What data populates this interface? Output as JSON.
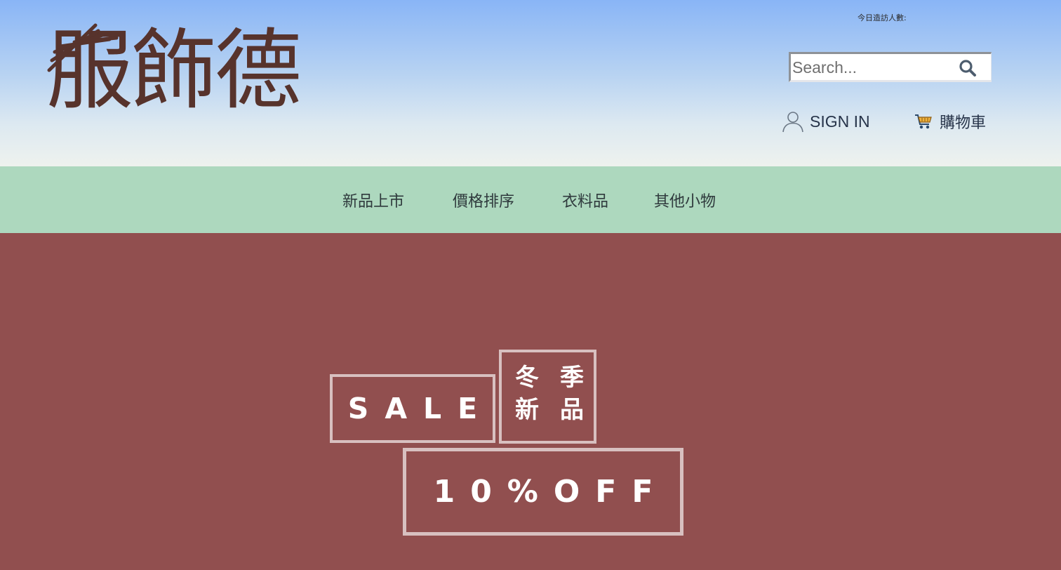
{
  "header": {
    "logo_text": "服飾德",
    "visitor_label": "今日造訪人數:",
    "search": {
      "placeholder": "Search..."
    },
    "signin_label": "SIGN IN",
    "cart_label": "購物車"
  },
  "nav": {
    "items": [
      {
        "label": "新品上市"
      },
      {
        "label": "價格排序"
      },
      {
        "label": "衣料品"
      },
      {
        "label": "其他小物"
      }
    ]
  },
  "hero": {
    "sale_text": "SALE",
    "season_chars": [
      "冬",
      "季",
      "新",
      "品"
    ],
    "discount_text": "10%OFF"
  },
  "colors": {
    "header_top": "#89b5f6",
    "header_bottom": "#eef2ee",
    "nav_bg": "#add8be",
    "hero_bg": "#914f4f",
    "logo_color": "#57332c",
    "banner_border": "#d8c0c0"
  },
  "icons": {
    "search": "search-icon",
    "user": "user-icon",
    "cart": "cart-icon"
  }
}
